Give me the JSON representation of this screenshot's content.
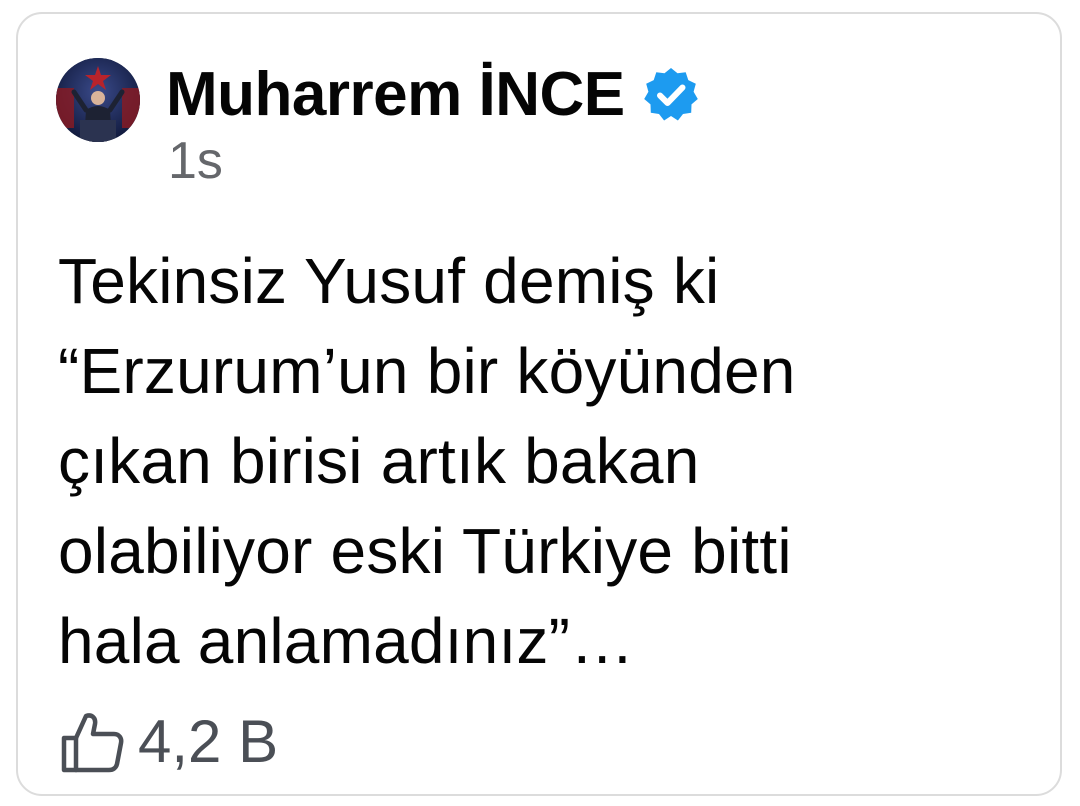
{
  "post": {
    "author": "Muharrem İNCE",
    "verified": true,
    "timestamp": "1s",
    "text_lines": [
      "Tekinsiz Yusuf demiş ki",
      "“Erzurum’un bir köyünden",
      "çıkan birisi artık bakan",
      "olabiliyor eski Türkiye bitti",
      "hala anlamadınız”…"
    ]
  },
  "footer": {
    "like_icon": "thumbs-up-icon",
    "like_count": "4,2 B"
  },
  "colors": {
    "verified_badge": "#1d9bf0",
    "text": "#050505",
    "secondary_text": "#65676b",
    "card_border": "#dcdcdc"
  }
}
